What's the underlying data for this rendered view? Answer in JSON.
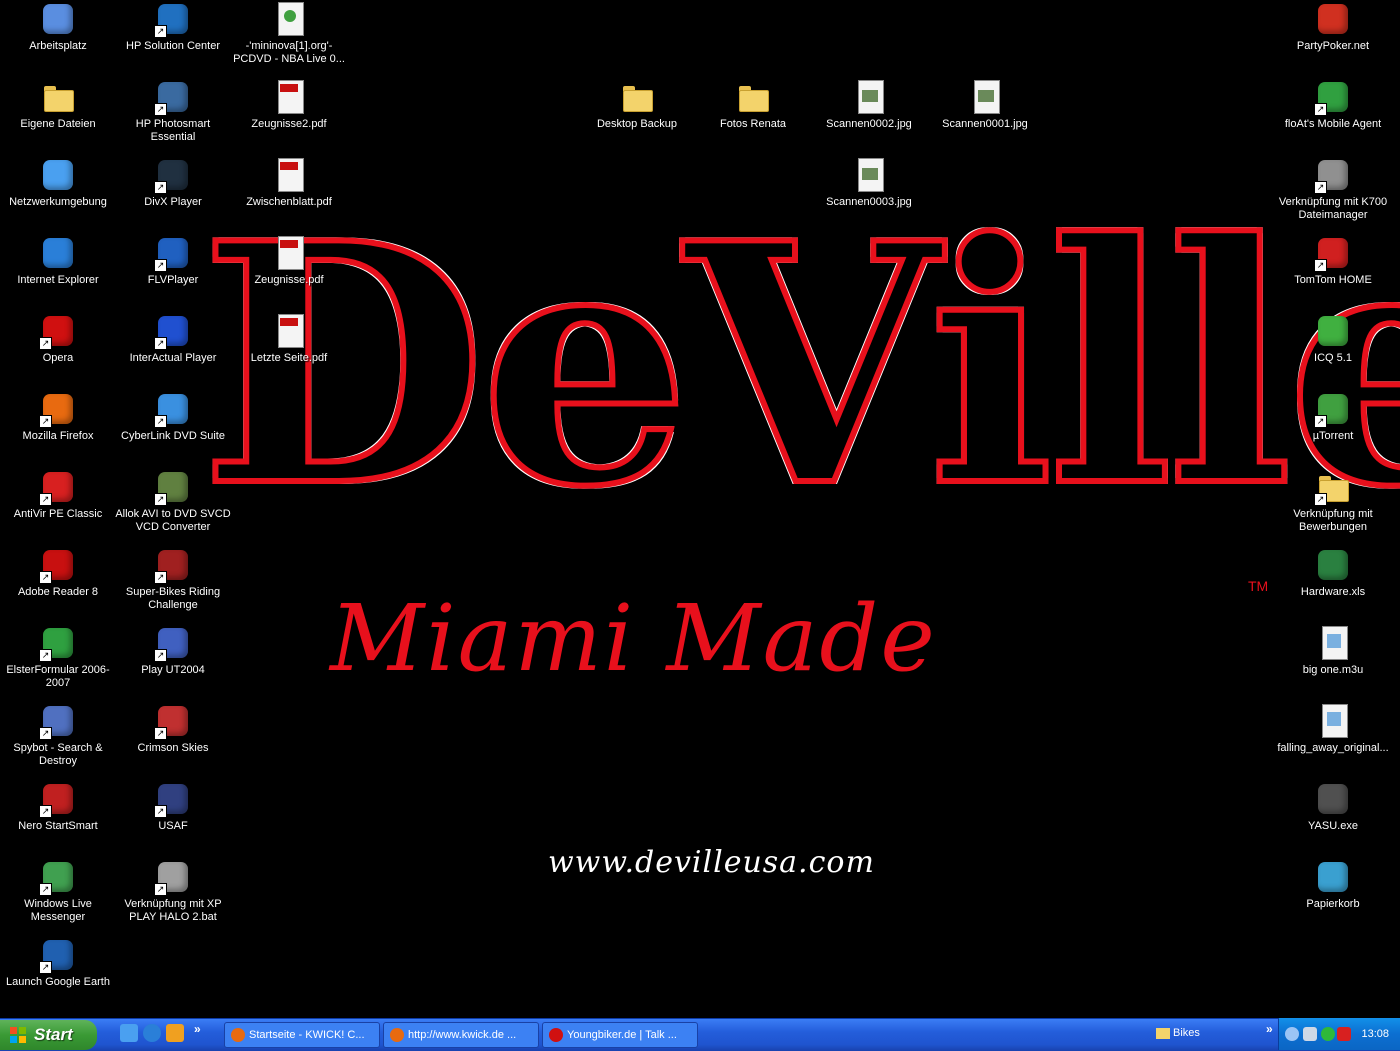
{
  "wallpaper": {
    "brand": "DeVille",
    "tagline": "Miami Made",
    "trademark": "TM",
    "url": "www.devilleusa.com"
  },
  "icons": {
    "col1": [
      {
        "label": "Arbeitsplatz",
        "icon": "computer-icon"
      },
      {
        "label": "Eigene Dateien",
        "icon": "documents-folder-icon"
      },
      {
        "label": "Netzwerkumgebung",
        "icon": "network-icon"
      },
      {
        "label": "Internet Explorer",
        "icon": "ie-icon"
      },
      {
        "label": "Opera",
        "icon": "opera-icon"
      },
      {
        "label": "Mozilla Firefox",
        "icon": "firefox-icon"
      },
      {
        "label": "AntiVir PE Classic",
        "icon": "antivir-icon"
      },
      {
        "label": "Adobe Reader 8",
        "icon": "adobe-reader-icon"
      },
      {
        "label": "ElsterFormular 2006-2007",
        "icon": "elster-icon"
      },
      {
        "label": "Spybot - Search & Destroy",
        "icon": "spybot-icon"
      },
      {
        "label": "Nero StartSmart",
        "icon": "nero-icon"
      },
      {
        "label": "Windows Live Messenger",
        "icon": "messenger-icon"
      },
      {
        "label": "Launch Google Earth",
        "icon": "google-earth-icon"
      }
    ],
    "col2": [
      {
        "label": "HP Solution Center",
        "icon": "hp-icon"
      },
      {
        "label": "HP Photosmart Essential",
        "icon": "hp-photosmart-icon"
      },
      {
        "label": "DivX Player",
        "icon": "divx-icon"
      },
      {
        "label": "FLVPlayer",
        "icon": "flvplayer-icon"
      },
      {
        "label": "InterActual Player",
        "icon": "interactual-icon"
      },
      {
        "label": "CyberLink DVD Suite",
        "icon": "cyberlink-icon"
      },
      {
        "label": "Allok AVI to DVD SVCD VCD Converter",
        "icon": "allok-icon"
      },
      {
        "label": "Super-Bikes Riding Challenge",
        "icon": "superbikes-icon"
      },
      {
        "label": "Play UT2004",
        "icon": "ut2004-icon"
      },
      {
        "label": "Crimson Skies",
        "icon": "crimson-skies-icon"
      },
      {
        "label": "USAF",
        "icon": "usaf-icon"
      },
      {
        "label": "Verknüpfung mit XP PLAY HALO 2.bat",
        "icon": "batch-file-icon"
      }
    ],
    "col3": [
      {
        "label": "-'mininova[1].org'- PCDVD - NBA Live 0...",
        "icon": "torrent-file-icon"
      },
      {
        "label": "Zeugnisse2.pdf",
        "icon": "pdf-icon"
      },
      {
        "label": "Zwischenblatt.pdf",
        "icon": "pdf-icon"
      },
      {
        "label": "Zeugnisse.pdf",
        "icon": "pdf-icon"
      },
      {
        "label": "Letzte Seite.pdf",
        "icon": "pdf-icon"
      }
    ],
    "middle": [
      {
        "label": "Desktop Backup",
        "icon": "folder-icon"
      },
      {
        "label": "Fotos Renata",
        "icon": "folder-icon"
      },
      {
        "label": "Scannen0002.jpg",
        "icon": "image-file-icon"
      },
      {
        "label": "Scannen0001.jpg",
        "icon": "image-file-icon"
      },
      {
        "label": "Scannen0003.jpg",
        "icon": "image-file-icon"
      }
    ],
    "right": [
      {
        "label": "PartyPoker.net",
        "icon": "partypoker-icon"
      },
      {
        "label": "floAt's Mobile Agent",
        "icon": "mobile-agent-icon"
      },
      {
        "label": "Verknüpfung mit K700 Dateimanager",
        "icon": "phone-manager-icon"
      },
      {
        "label": "TomTom HOME",
        "icon": "tomtom-icon"
      },
      {
        "label": "ICQ 5.1",
        "icon": "icq-icon"
      },
      {
        "label": "µTorrent",
        "icon": "utorrent-icon"
      },
      {
        "label": "Verknüpfung mit Bewerbungen",
        "icon": "folder-shortcut-icon"
      },
      {
        "label": "Hardware.xls",
        "icon": "excel-icon"
      },
      {
        "label": "big one.m3u",
        "icon": "playlist-icon"
      },
      {
        "label": "falling_away_original...",
        "icon": "playlist-icon"
      },
      {
        "label": "YASU.exe",
        "icon": "yasu-icon"
      },
      {
        "label": "Papierkorb",
        "icon": "recycle-bin-icon"
      }
    ]
  },
  "taskbar": {
    "start_label": "Start",
    "overflow": "»",
    "tasks": [
      {
        "label": "Startseite - KWICK! C...",
        "icon": "firefox-icon"
      },
      {
        "label": "http://www.kwick.de ...",
        "icon": "firefox-icon"
      },
      {
        "label": "Youngbiker.de | Talk ...",
        "icon": "opera-icon"
      }
    ],
    "folder_label": "Bikes",
    "clock": "13:08"
  },
  "colors": {
    "brand_red": "#e8101c",
    "taskbar_blue": "#245edb",
    "start_green": "#3a9a35"
  }
}
